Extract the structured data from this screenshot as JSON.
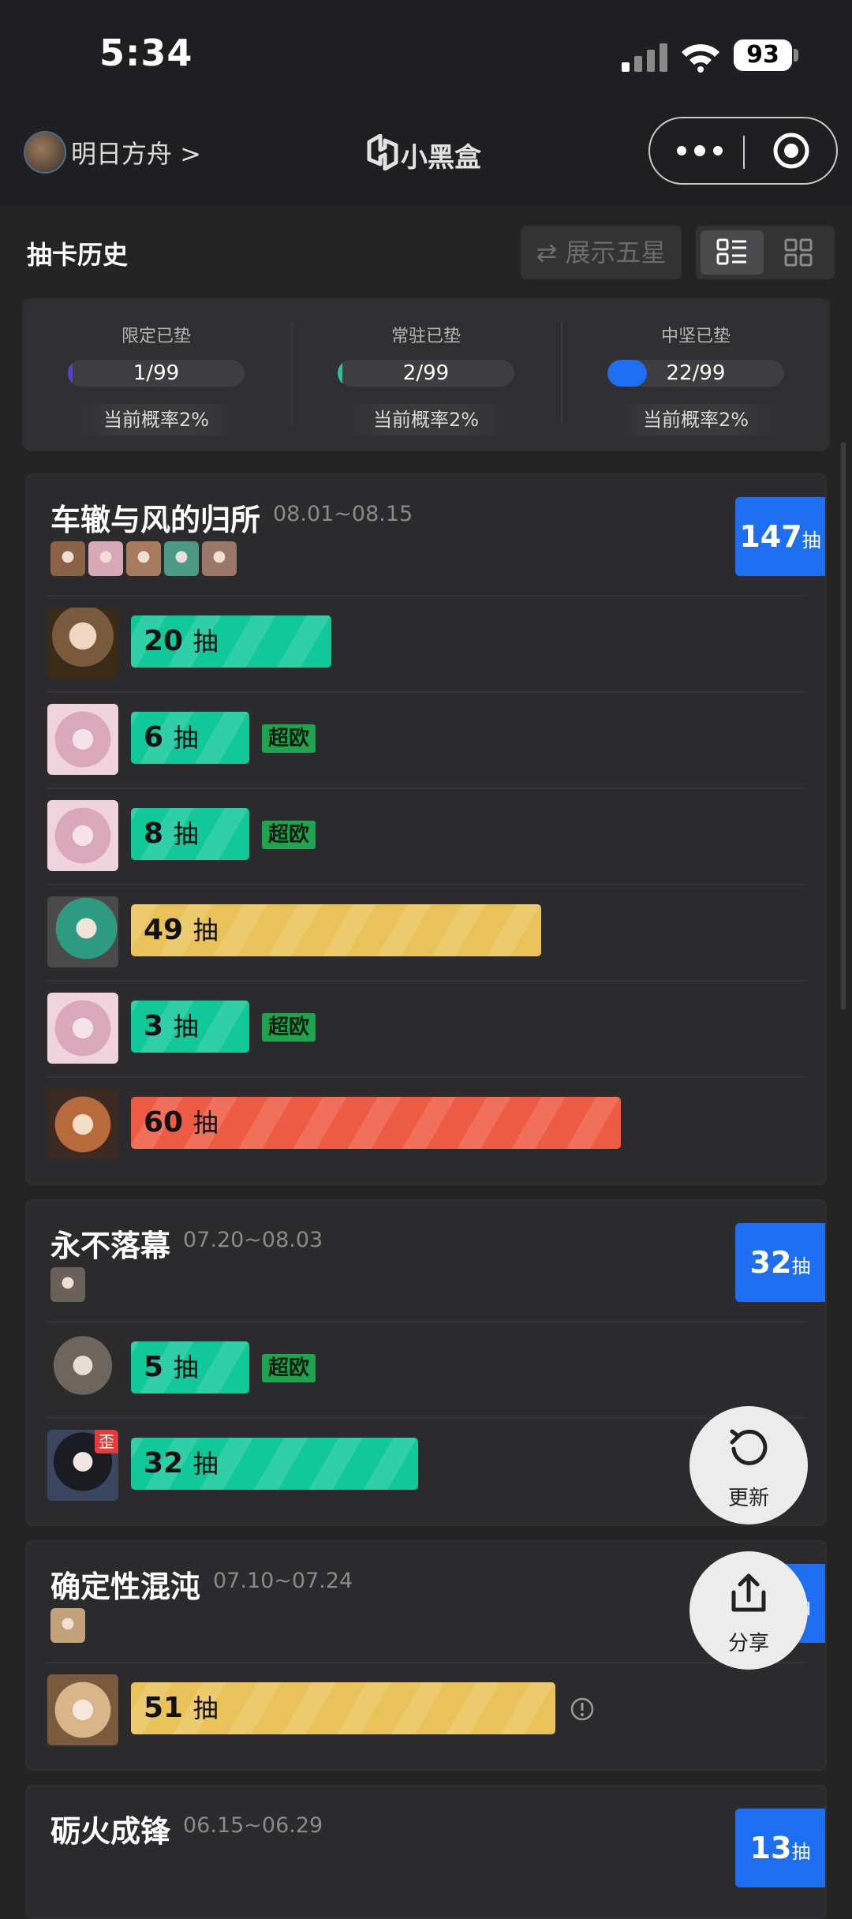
{
  "status_bar": {
    "time": "5:34",
    "battery": "93"
  },
  "nav": {
    "game": "明日方舟 >",
    "app_title": "小黑盒"
  },
  "header": {
    "title": "抽卡历史",
    "show_five_star": "⇄ 展示五星"
  },
  "stats": [
    {
      "label": "限定已垫",
      "value": "1/99",
      "progress": 0.0101,
      "color": "#5b3dd6",
      "rate": "当前概率2%"
    },
    {
      "label": "常驻已垫",
      "value": "2/99",
      "progress": 0.0202,
      "color": "#1ec7a6",
      "rate": "当前概率2%"
    },
    {
      "label": "中坚已垫",
      "value": "22/99",
      "progress": 0.2222,
      "color": "#1d6ef0",
      "rate": "当前概率2%"
    }
  ],
  "pull_unit": "抽",
  "pools": [
    {
      "title": "车辙与风的归所",
      "date": "08.01~08.15",
      "total": "147",
      "minis": [
        "#8a6246",
        "#d7a9b6",
        "#a87a5e",
        "#4a9a86",
        "#9a7868"
      ],
      "rows": [
        {
          "pulls": "20",
          "bar_color": "#11c89a",
          "avatar": "hood",
          "tag": "",
          "wai": "",
          "warn": false
        },
        {
          "pulls": "6",
          "bar_color": "#11c89a",
          "avatar": "bunny",
          "tag": "超欧",
          "wai": "",
          "warn": false
        },
        {
          "pulls": "8",
          "bar_color": "#11c89a",
          "avatar": "bunny",
          "tag": "超欧",
          "wai": "",
          "warn": false
        },
        {
          "pulls": "49",
          "bar_color": "#e9c35a",
          "avatar": "green",
          "tag": "",
          "wai": "",
          "warn": false
        },
        {
          "pulls": "3",
          "bar_color": "#11c89a",
          "avatar": "bunny",
          "tag": "超欧",
          "wai": "",
          "warn": false
        },
        {
          "pulls": "60",
          "bar_color": "#ee5b44",
          "avatar": "fox",
          "tag": "",
          "wai": "",
          "warn": false
        }
      ]
    },
    {
      "title": "永不落幕",
      "date": "07.20~08.03",
      "total": "32",
      "minis": [
        "#6a625a"
      ],
      "rows": [
        {
          "pulls": "5",
          "bar_color": "#11c89a",
          "avatar": "grey",
          "tag": "超欧",
          "wai": "",
          "warn": false
        },
        {
          "pulls": "32",
          "bar_color": "#11c89a",
          "avatar": "dark",
          "tag": "",
          "wai": "歪",
          "warn": false
        }
      ]
    },
    {
      "title": "确定性混沌",
      "date": "07.10~07.24",
      "total": "51",
      "minis": [
        "#c2a27a"
      ],
      "rows": [
        {
          "pulls": "51",
          "bar_color": "#e9c35a",
          "avatar": "blonde",
          "tag": "",
          "wai": "",
          "warn": true
        }
      ]
    },
    {
      "title": "砺火成锋",
      "date": "06.15~06.29",
      "total": "13",
      "minis": [],
      "rows": []
    }
  ],
  "float_buttons": {
    "refresh": "更新",
    "share": "分享"
  }
}
